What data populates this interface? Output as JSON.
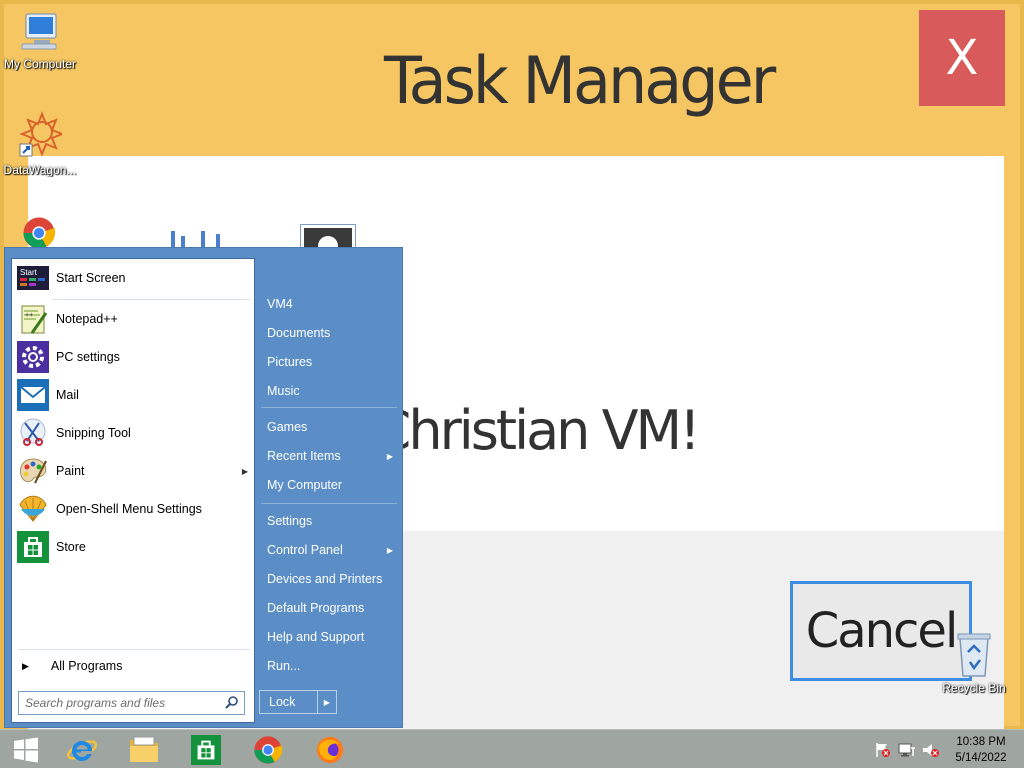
{
  "background_window": {
    "title": "Task Manager",
    "close_label": "X",
    "content_text": "n a Christian VM!",
    "cancel_label": "Cancel"
  },
  "desktop_icons": [
    {
      "label": "My Computer",
      "icon": "computer-icon"
    },
    {
      "label": "DataWagon...",
      "icon": "datawagon-icon"
    },
    {
      "label": "Recycle Bin",
      "icon": "recycle-bin-icon"
    }
  ],
  "start_menu": {
    "programs": [
      {
        "label": "Start Screen",
        "icon": "start-screen-icon"
      },
      {
        "label": "Notepad++",
        "icon": "notepadpp-icon"
      },
      {
        "label": "PC settings",
        "icon": "gear-icon"
      },
      {
        "label": "Mail",
        "icon": "mail-icon"
      },
      {
        "label": "Snipping Tool",
        "icon": "scissors-icon"
      },
      {
        "label": "Paint",
        "icon": "palette-icon"
      },
      {
        "label": "Open-Shell Menu Settings",
        "icon": "shell-icon"
      },
      {
        "label": "Store",
        "icon": "store-icon"
      }
    ],
    "all_programs": "All Programs",
    "search_placeholder": "Search programs and files",
    "right_items": [
      {
        "label": "VM4"
      },
      {
        "label": "Documents"
      },
      {
        "label": "Pictures"
      },
      {
        "label": "Music"
      },
      {
        "label": "Games"
      },
      {
        "label": "Recent Items"
      },
      {
        "label": "My Computer"
      },
      {
        "label": "Settings"
      },
      {
        "label": "Control Panel"
      },
      {
        "label": "Devices and Printers"
      },
      {
        "label": "Default Programs"
      },
      {
        "label": "Help and Support"
      },
      {
        "label": "Run..."
      }
    ],
    "lock_label": "Lock"
  },
  "taskbar": {
    "apps": [
      "windows-start-icon",
      "internet-explorer-icon",
      "file-explorer-icon",
      "store-icon",
      "chrome-icon",
      "firefox-icon"
    ],
    "tray": [
      "action-center-flag-icon",
      "network-icon",
      "volume-muted-icon"
    ],
    "time": "10:38 PM",
    "date": "5/14/2022"
  },
  "colors": {
    "accent": "#5b8ec6",
    "window_bg": "#f5c661",
    "close_red": "#d95a5a",
    "taskbar": "#9fa6a2"
  }
}
